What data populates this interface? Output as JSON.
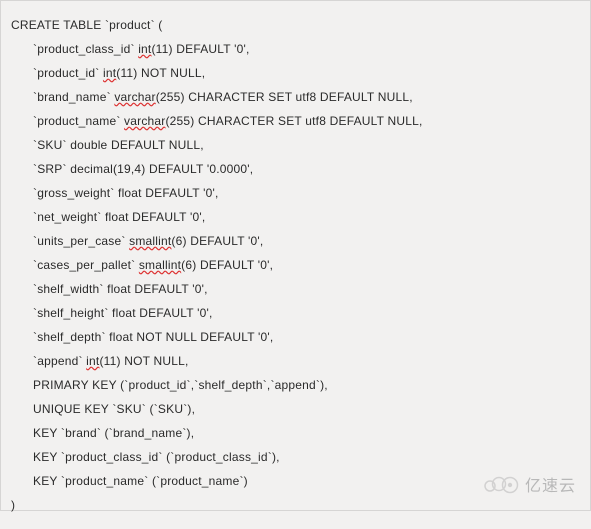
{
  "code": {
    "open": "CREATE TABLE `product` (",
    "lines": [
      {
        "pre": "`product_class_id` ",
        "typo": "int",
        "post": "(11) DEFAULT '0',"
      },
      {
        "pre": "`product_id` ",
        "typo": "int",
        "post": "(11) NOT NULL,"
      },
      {
        "pre": "`brand_name` ",
        "typo": "varchar",
        "post": "(255) CHARACTER SET utf8 DEFAULT NULL,"
      },
      {
        "pre": "`product_name` ",
        "typo": "varchar",
        "post": "(255) CHARACTER SET utf8 DEFAULT NULL,"
      },
      {
        "pre": "`SKU` double DEFAULT NULL,",
        "typo": "",
        "post": ""
      },
      {
        "pre": "`SRP` decimal(19,4) DEFAULT '0.0000',",
        "typo": "",
        "post": ""
      },
      {
        "pre": "`gross_weight` float DEFAULT '0',",
        "typo": "",
        "post": ""
      },
      {
        "pre": "`net_weight` float DEFAULT '0',",
        "typo": "",
        "post": ""
      },
      {
        "pre": "`units_per_case` ",
        "typo": "smallint",
        "post": "(6) DEFAULT '0',"
      },
      {
        "pre": "`cases_per_pallet` ",
        "typo": "smallint",
        "post": "(6) DEFAULT '0',"
      },
      {
        "pre": "`shelf_width` float DEFAULT '0',",
        "typo": "",
        "post": ""
      },
      {
        "pre": "`shelf_height` float DEFAULT '0',",
        "typo": "",
        "post": ""
      },
      {
        "pre": "`shelf_depth` float NOT NULL DEFAULT '0',",
        "typo": "",
        "post": ""
      },
      {
        "pre": "`append` ",
        "typo": "int",
        "post": "(11) NOT NULL,"
      },
      {
        "pre": "PRIMARY KEY (`product_id`,`shelf_depth`,`append`),",
        "typo": "",
        "post": ""
      },
      {
        "pre": "UNIQUE KEY `SKU` (`SKU`),",
        "typo": "",
        "post": ""
      },
      {
        "pre": "KEY `brand` (`brand_name`),",
        "typo": "",
        "post": ""
      },
      {
        "pre": "KEY `product_class_id` (`product_class_id`),",
        "typo": "",
        "post": ""
      },
      {
        "pre": "KEY `product_name` (`product_name`)",
        "typo": "",
        "post": ""
      }
    ],
    "close": ")"
  },
  "watermark": "亿速云"
}
